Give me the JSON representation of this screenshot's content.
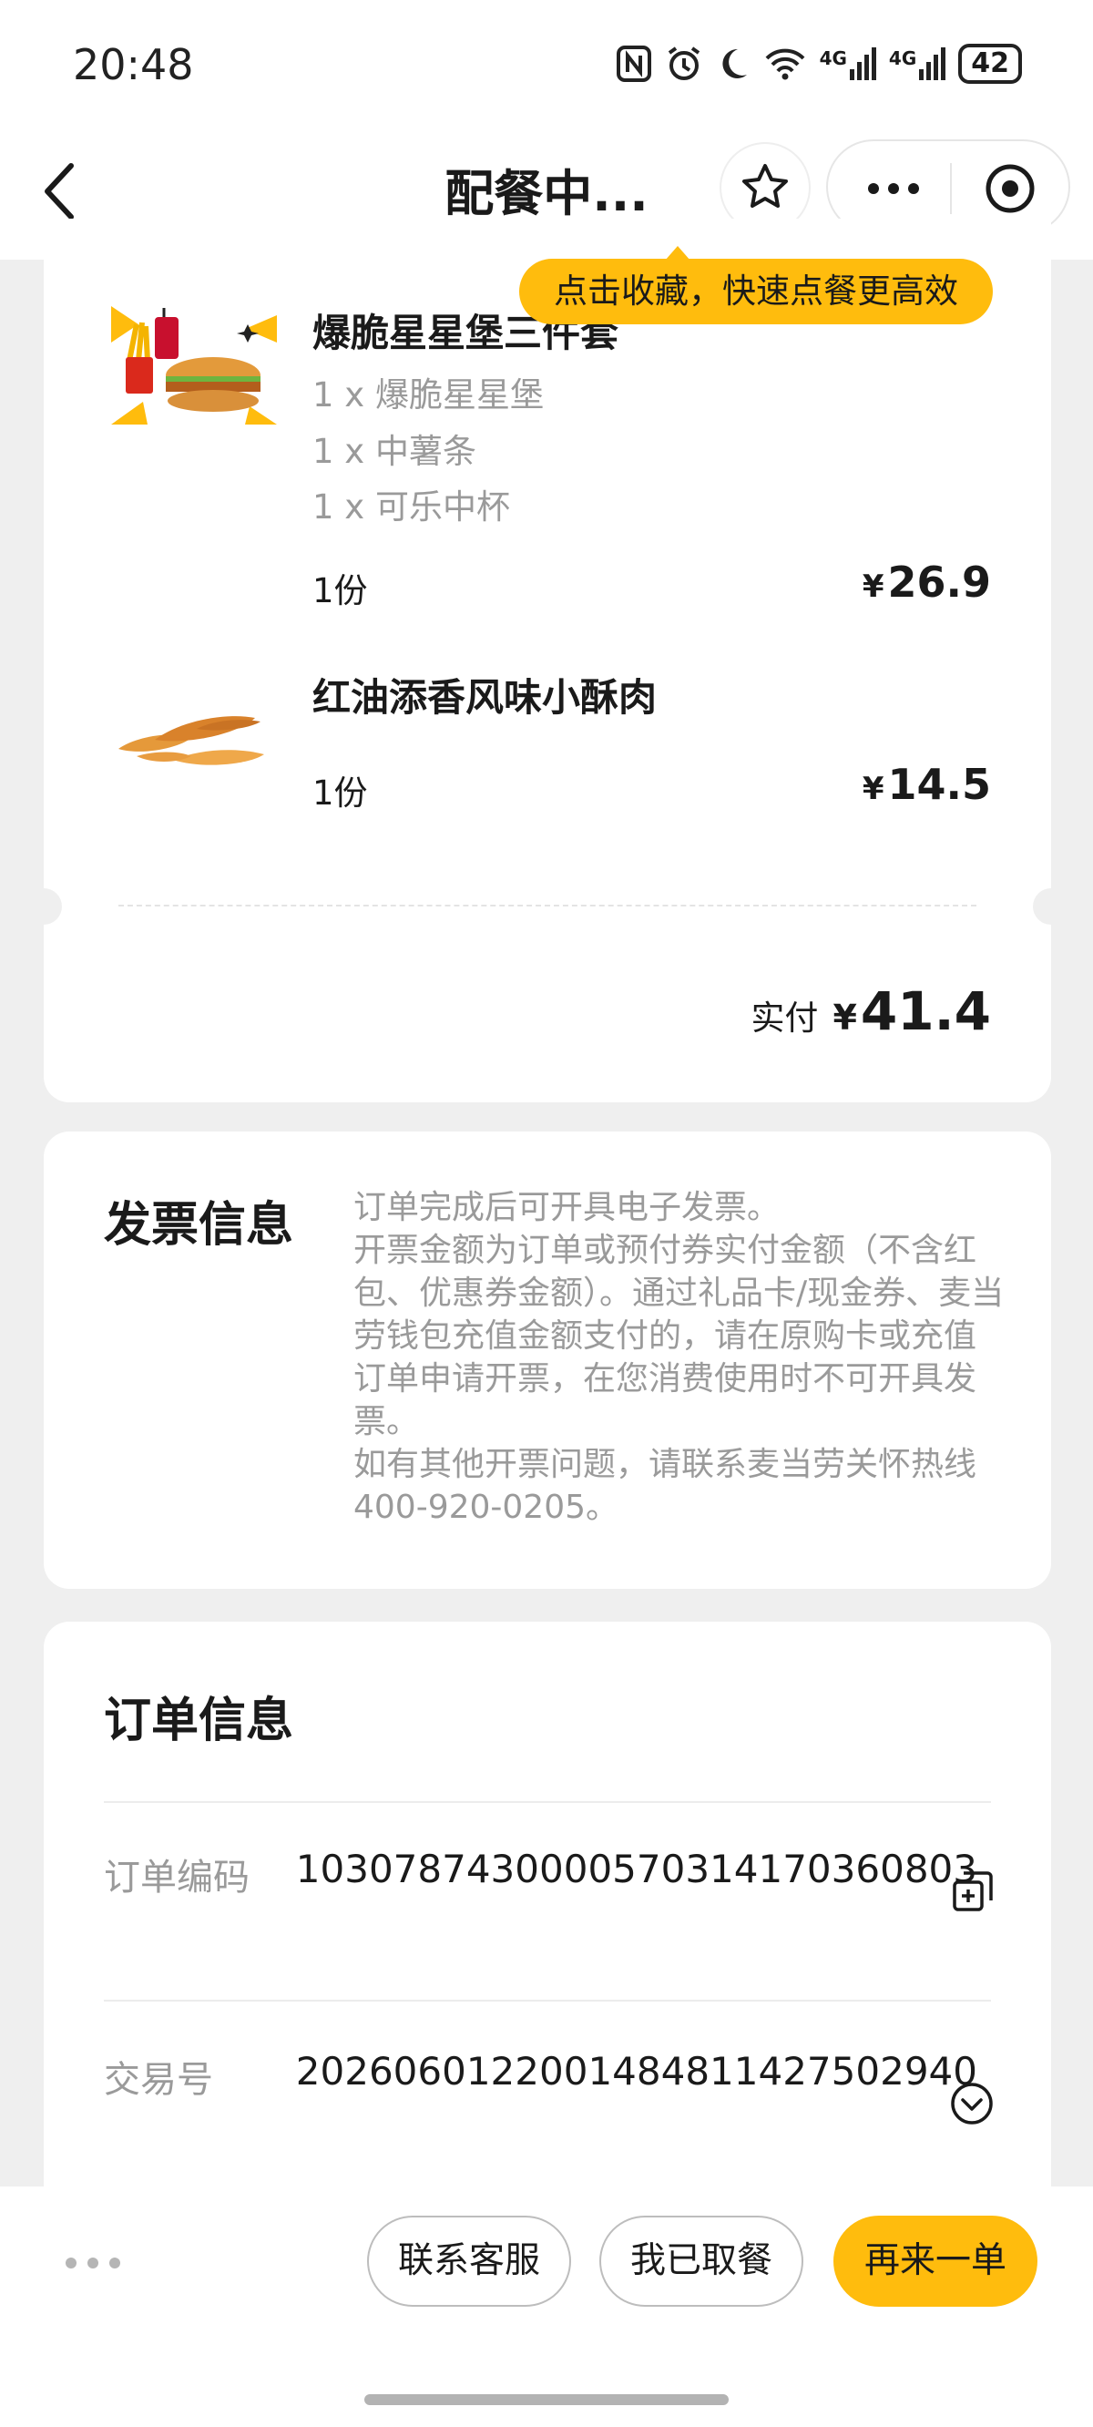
{
  "status_bar": {
    "time": "20:48",
    "battery": "42",
    "net1": "4G",
    "net2": "4G"
  },
  "nav": {
    "title": "配餐中...",
    "icons": [
      "back-arrow-icon",
      "star-icon",
      "more-icon",
      "target-icon"
    ]
  },
  "tooltip": "点击收藏，快速点餐更高效",
  "order_items": [
    {
      "name": "爆脆星星堡三件套",
      "components": [
        "1 x 爆脆星星堡",
        "1 x 中薯条",
        "1 x 可乐中杯"
      ],
      "qty": "1份",
      "price_symbol": "¥",
      "price": "26.9"
    },
    {
      "name": "红油添香风味小酥肉",
      "components": [],
      "qty": "1份",
      "price_symbol": "¥",
      "price": "14.5"
    }
  ],
  "total": {
    "label": "实付",
    "symbol": "¥",
    "amount": "41.4"
  },
  "invoice": {
    "title": "发票信息",
    "lines": [
      "订单完成后可开具电子发票。",
      "开票金额为订单或预付券实付金额（不含红包、优惠券金额）。通过礼品卡/现金券、麦当劳钱包充值金额支付的，请在原购卡或充值订单申请开票，在您消费使用时不可开具发票。",
      "如有其他开票问题，请联系麦当劳关怀热线400-920-0205。"
    ]
  },
  "order_info": {
    "title": "订单信息",
    "rows": [
      {
        "label": "订单编码",
        "value": "1030787430000570314170360803",
        "icon": "copy-icon"
      },
      {
        "label": "交易号",
        "value": "2026060122001484811427502940",
        "icon": "chevron-down-circle-icon"
      }
    ]
  },
  "bottom_bar": {
    "contact_label": "联系客服",
    "picked_label": "我已取餐",
    "reorder_label": "再来一单"
  },
  "colors": {
    "accent": "#ffbc0d",
    "background": "#efefef",
    "muted_text": "#9a9a9a"
  }
}
